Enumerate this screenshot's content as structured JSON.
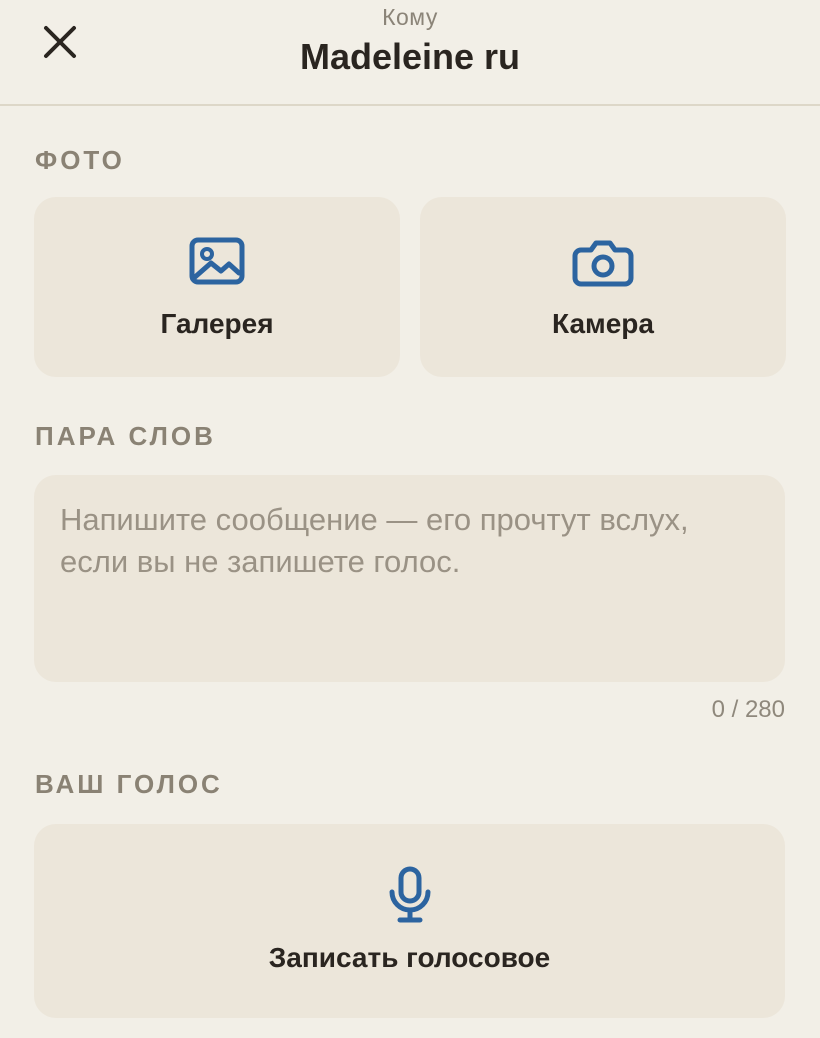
{
  "header": {
    "subtitle": "Кому",
    "title": "Madeleine ru",
    "close_icon": "close-icon"
  },
  "photo_section": {
    "label": "ФОТО",
    "gallery": {
      "label": "Галерея",
      "icon": "image-icon"
    },
    "camera": {
      "label": "Камера",
      "icon": "camera-icon"
    }
  },
  "message_section": {
    "label": "ПАРА СЛОВ",
    "placeholder": "Напишите сообщение — его прочтут вслух, если вы не запишете голос.",
    "value": "",
    "counter": "0 / 280"
  },
  "voice_section": {
    "label": "ВАШ ГОЛОС",
    "record": {
      "label": "Записать голосовое",
      "icon": "microphone-icon"
    }
  },
  "colors": {
    "background": "#f2efe7",
    "tile": "#ece6da",
    "accent": "#2c64a0",
    "text": "#2a2520",
    "muted": "#8a8274"
  }
}
